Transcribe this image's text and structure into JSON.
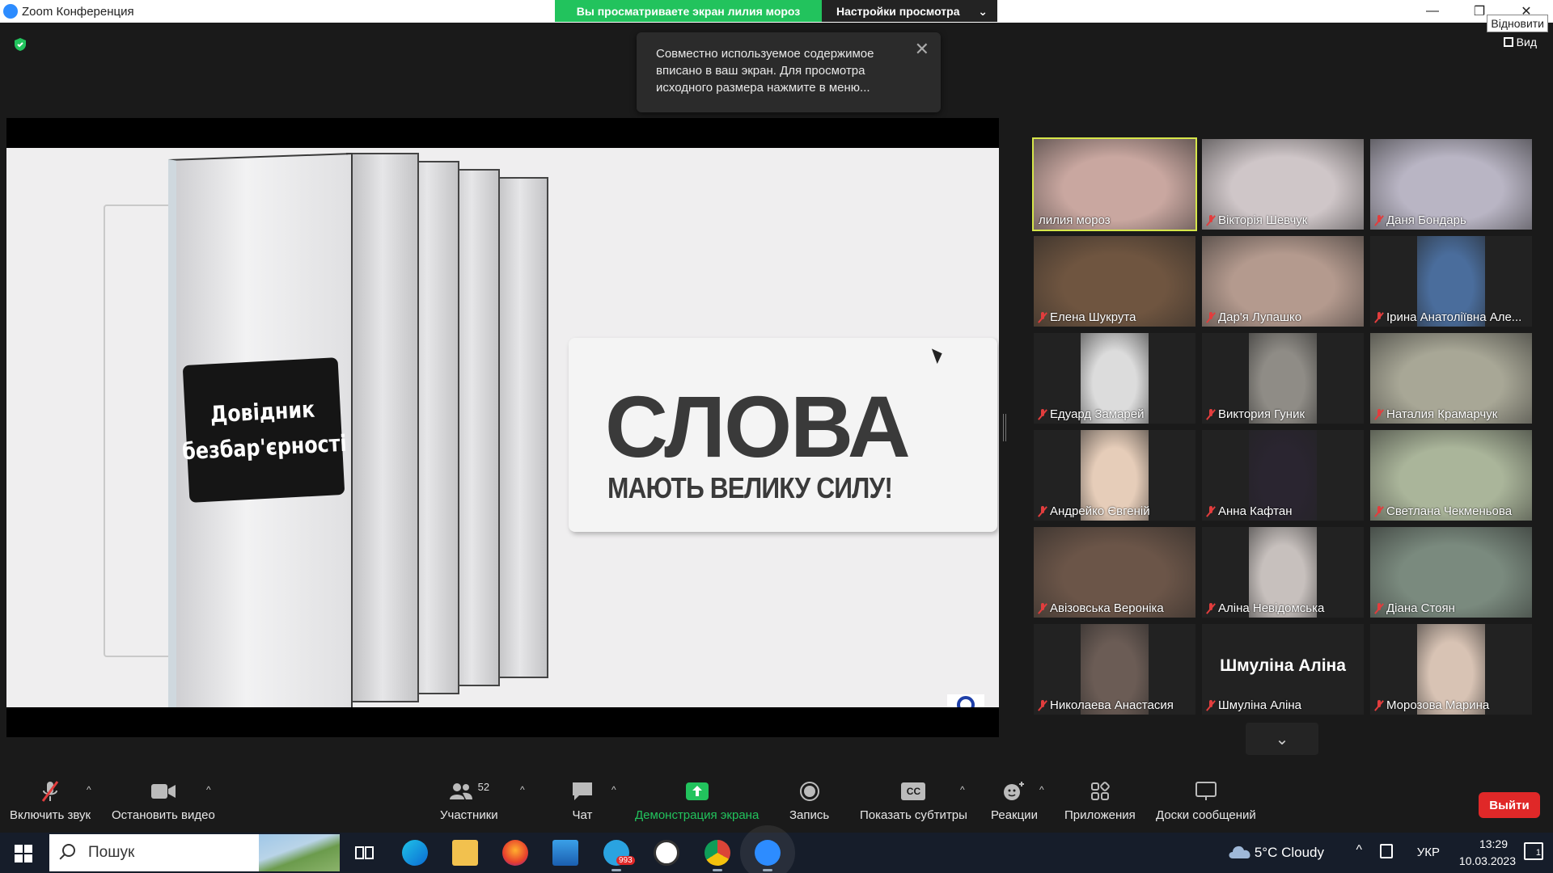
{
  "window": {
    "title": "Zoom Конференция",
    "restore_tooltip": "Відновити"
  },
  "share_banner": {
    "viewing": "Вы просматриваете экран лилия мороз",
    "view_settings": "Настройки просмотра"
  },
  "view_button": "Вид",
  "notice": {
    "text": "Совместно используемое содержимое вписано в ваш экран. Для просмотра исходного размера нажмите в меню..."
  },
  "slide": {
    "binder_label_line1": "Довідник",
    "binder_label_line2": "безбар'єрності",
    "title": "СЛОВА",
    "subtitle": "МАЮТЬ ВЕЛИКУ СИЛУ!"
  },
  "participants": [
    {
      "name": "лилия мороз",
      "muted": false,
      "active": true,
      "bg": "#c9a7a0",
      "video": "wide"
    },
    {
      "name": "Вікторія Шевчук",
      "muted": true,
      "bg": "#cfc6c8",
      "video": "wide"
    },
    {
      "name": "Даня Бондарь",
      "muted": true,
      "bg": "#b9b5c4",
      "video": "wide"
    },
    {
      "name": "Елена Шукрута",
      "muted": true,
      "bg": "#6f5540",
      "video": "wide"
    },
    {
      "name": "Дар'я Лупашко",
      "muted": true,
      "bg": "#b49a8e",
      "video": "wide"
    },
    {
      "name": "Ірина Анатоліївна Але...",
      "muted": true,
      "bg": "#4a6d9c",
      "video": "narrow"
    },
    {
      "name": "Едуард Замарей",
      "muted": true,
      "bg": "#dcdcdc",
      "video": "narrow"
    },
    {
      "name": "Виктория Гуник",
      "muted": true,
      "bg": "#8f8c86",
      "video": "narrow"
    },
    {
      "name": "Наталия Крамарчук",
      "muted": true,
      "bg": "#a8a796",
      "video": "wide"
    },
    {
      "name": "Андрейко Євгеній",
      "muted": true,
      "bg": "#e6cdb9",
      "video": "narrow"
    },
    {
      "name": "Анна Кафтан",
      "muted": true,
      "bg": "#2a2530",
      "video": "narrow"
    },
    {
      "name": "Светлана Чекменьова",
      "muted": true,
      "bg": "#aab59a",
      "video": "wide"
    },
    {
      "name": "Авізовська Вероніка",
      "muted": true,
      "bg": "#6b5548",
      "video": "wide"
    },
    {
      "name": "Аліна Невідомська",
      "muted": true,
      "bg": "#c7c0bd",
      "video": "narrow"
    },
    {
      "name": "Діана Стоян",
      "muted": true,
      "bg": "#7a8a7e",
      "video": "wide"
    },
    {
      "name": "Николаева Анастасия",
      "muted": true,
      "bg": "#6b5c55",
      "video": "narrow"
    },
    {
      "name": "Шмуліна Аліна",
      "muted": true,
      "bg": "#232323",
      "video": "none",
      "display_text": "Шмуліна Аліна"
    },
    {
      "name": "Морозова Марина",
      "muted": true,
      "bg": "#d8c3b4",
      "video": "narrow"
    }
  ],
  "toolbar": {
    "unmute": "Включить звук",
    "stop_video": "Остановить видео",
    "participants": "Участники",
    "participants_count": "52",
    "chat": "Чат",
    "share_screen": "Демонстрация экрана",
    "record": "Запись",
    "captions": "Показать субтитры",
    "reactions": "Реакции",
    "apps": "Приложения",
    "whiteboards": "Доски сообщений",
    "leave": "Выйти",
    "cc_icon_text": "CC"
  },
  "taskbar": {
    "search": "Пошук",
    "telegram_badge": "993",
    "weather": "5°C  Cloudy",
    "language": "УКР",
    "time": "13:29",
    "date": "10.03.2023",
    "notifications_count": "1"
  },
  "colors": {
    "green": "#22c35d",
    "red": "#e02828",
    "zoom_blue": "#2d8cff",
    "active_speaker": "#d6e64a"
  }
}
